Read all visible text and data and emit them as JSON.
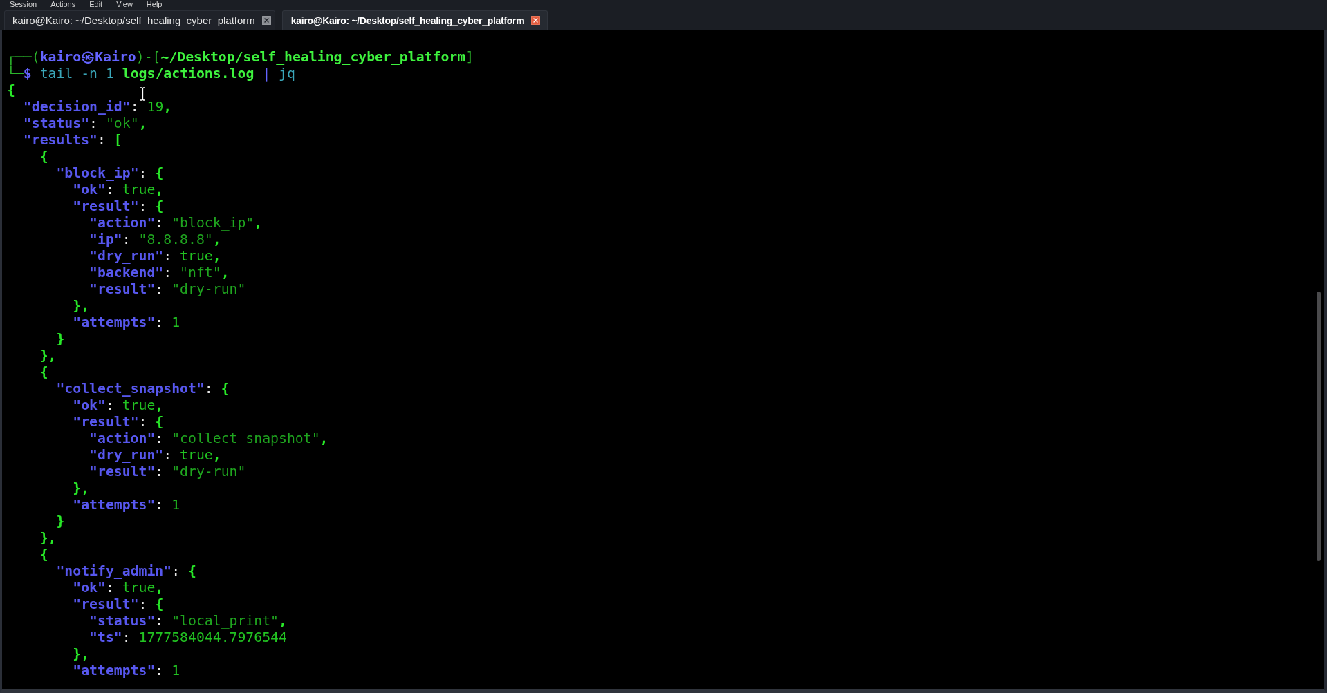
{
  "menu": [
    "Session",
    "Actions",
    "Edit",
    "View",
    "Help"
  ],
  "tabs": [
    {
      "label": "kairo@Kairo: ~/Desktop/self_healing_cyber_platform",
      "selected": false
    },
    {
      "label": "kairo@Kairo: ~/Desktop/self_healing_cyber_platform",
      "selected": true
    }
  ],
  "terminal": {
    "prompt": [
      {
        "segments": [
          {
            "text": "┌──(",
            "kind": "frame"
          },
          {
            "text": "kairo㉿Kairo",
            "kind": "accent"
          },
          {
            "text": ")-[",
            "kind": "frame"
          },
          {
            "text": "~/Desktop/self_healing_cyber_platform",
            "kind": "path"
          },
          {
            "text": "]",
            "kind": "frame"
          }
        ]
      },
      {
        "segments": [
          {
            "text": "└─",
            "kind": "frame"
          },
          {
            "text": "$",
            "kind": "accent"
          },
          {
            "text": " tail -n 1 ",
            "kind": "command"
          },
          {
            "text": "logs/actions.log",
            "kind": "path"
          },
          {
            "text": " |",
            "kind": "accent"
          },
          {
            "text": " jq",
            "kind": "command"
          }
        ]
      }
    ],
    "output": [
      {
        "segments": [
          {
            "text": "{",
            "kind": "punct"
          }
        ],
        "children": [
          {
            "segments": [
              {
                "text": "\"decision_id\"",
                "kind": "key"
              },
              {
                "text": ": ",
                "kind": "colon"
              },
              {
                "text": "19",
                "kind": "literal"
              },
              {
                "text": ",",
                "kind": "punct"
              }
            ]
          },
          {
            "segments": [
              {
                "text": "\"status\"",
                "kind": "key"
              },
              {
                "text": ": ",
                "kind": "colon"
              },
              {
                "text": "\"ok\"",
                "kind": "string"
              },
              {
                "text": ",",
                "kind": "punct"
              }
            ]
          },
          {
            "segments": [
              {
                "text": "\"results\"",
                "kind": "key"
              },
              {
                "text": ": ",
                "kind": "colon"
              },
              {
                "text": "[",
                "kind": "punct"
              }
            ],
            "children": [
              {
                "segments": [
                  {
                    "text": "{",
                    "kind": "punct"
                  }
                ],
                "children": [
                  {
                    "segments": [
                      {
                        "text": "\"block_ip\"",
                        "kind": "key"
                      },
                      {
                        "text": ": ",
                        "kind": "colon"
                      },
                      {
                        "text": "{",
                        "kind": "punct"
                      }
                    ],
                    "children": [
                      {
                        "segments": [
                          {
                            "text": "\"ok\"",
                            "kind": "key"
                          },
                          {
                            "text": ": ",
                            "kind": "colon"
                          },
                          {
                            "text": "true",
                            "kind": "literal"
                          },
                          {
                            "text": ",",
                            "kind": "punct"
                          }
                        ]
                      },
                      {
                        "segments": [
                          {
                            "text": "\"result\"",
                            "kind": "key"
                          },
                          {
                            "text": ": ",
                            "kind": "colon"
                          },
                          {
                            "text": "{",
                            "kind": "punct"
                          }
                        ],
                        "children": [
                          {
                            "segments": [
                              {
                                "text": "\"action\"",
                                "kind": "key"
                              },
                              {
                                "text": ": ",
                                "kind": "colon"
                              },
                              {
                                "text": "\"block_ip\"",
                                "kind": "string"
                              },
                              {
                                "text": ",",
                                "kind": "punct"
                              }
                            ]
                          },
                          {
                            "segments": [
                              {
                                "text": "\"ip\"",
                                "kind": "key"
                              },
                              {
                                "text": ": ",
                                "kind": "colon"
                              },
                              {
                                "text": "\"8.8.8.8\"",
                                "kind": "string"
                              },
                              {
                                "text": ",",
                                "kind": "punct"
                              }
                            ]
                          },
                          {
                            "segments": [
                              {
                                "text": "\"dry_run\"",
                                "kind": "key"
                              },
                              {
                                "text": ": ",
                                "kind": "colon"
                              },
                              {
                                "text": "true",
                                "kind": "literal"
                              },
                              {
                                "text": ",",
                                "kind": "punct"
                              }
                            ]
                          },
                          {
                            "segments": [
                              {
                                "text": "\"backend\"",
                                "kind": "key"
                              },
                              {
                                "text": ": ",
                                "kind": "colon"
                              },
                              {
                                "text": "\"nft\"",
                                "kind": "string"
                              },
                              {
                                "text": ",",
                                "kind": "punct"
                              }
                            ]
                          },
                          {
                            "segments": [
                              {
                                "text": "\"result\"",
                                "kind": "key"
                              },
                              {
                                "text": ": ",
                                "kind": "colon"
                              },
                              {
                                "text": "\"dry-run\"",
                                "kind": "string"
                              }
                            ]
                          }
                        ]
                      },
                      {
                        "segments": [
                          {
                            "text": "}",
                            "kind": "punct"
                          },
                          {
                            "text": ",",
                            "kind": "punct"
                          }
                        ]
                      },
                      {
                        "segments": [
                          {
                            "text": "\"attempts\"",
                            "kind": "key"
                          },
                          {
                            "text": ": ",
                            "kind": "colon"
                          },
                          {
                            "text": "1",
                            "kind": "literal"
                          }
                        ]
                      }
                    ]
                  },
                  {
                    "segments": [
                      {
                        "text": "}",
                        "kind": "punct"
                      }
                    ]
                  }
                ]
              },
              {
                "segments": [
                  {
                    "text": "}",
                    "kind": "punct"
                  },
                  {
                    "text": ",",
                    "kind": "punct"
                  }
                ]
              },
              {
                "segments": [
                  {
                    "text": "{",
                    "kind": "punct"
                  }
                ],
                "children": [
                  {
                    "segments": [
                      {
                        "text": "\"collect_snapshot\"",
                        "kind": "key"
                      },
                      {
                        "text": ": ",
                        "kind": "colon"
                      },
                      {
                        "text": "{",
                        "kind": "punct"
                      }
                    ],
                    "children": [
                      {
                        "segments": [
                          {
                            "text": "\"ok\"",
                            "kind": "key"
                          },
                          {
                            "text": ": ",
                            "kind": "colon"
                          },
                          {
                            "text": "true",
                            "kind": "literal"
                          },
                          {
                            "text": ",",
                            "kind": "punct"
                          }
                        ]
                      },
                      {
                        "segments": [
                          {
                            "text": "\"result\"",
                            "kind": "key"
                          },
                          {
                            "text": ": ",
                            "kind": "colon"
                          },
                          {
                            "text": "{",
                            "kind": "punct"
                          }
                        ],
                        "children": [
                          {
                            "segments": [
                              {
                                "text": "\"action\"",
                                "kind": "key"
                              },
                              {
                                "text": ": ",
                                "kind": "colon"
                              },
                              {
                                "text": "\"collect_snapshot\"",
                                "kind": "string"
                              },
                              {
                                "text": ",",
                                "kind": "punct"
                              }
                            ]
                          },
                          {
                            "segments": [
                              {
                                "text": "\"dry_run\"",
                                "kind": "key"
                              },
                              {
                                "text": ": ",
                                "kind": "colon"
                              },
                              {
                                "text": "true",
                                "kind": "literal"
                              },
                              {
                                "text": ",",
                                "kind": "punct"
                              }
                            ]
                          },
                          {
                            "segments": [
                              {
                                "text": "\"result\"",
                                "kind": "key"
                              },
                              {
                                "text": ": ",
                                "kind": "colon"
                              },
                              {
                                "text": "\"dry-run\"",
                                "kind": "string"
                              }
                            ]
                          }
                        ]
                      },
                      {
                        "segments": [
                          {
                            "text": "}",
                            "kind": "punct"
                          },
                          {
                            "text": ",",
                            "kind": "punct"
                          }
                        ]
                      },
                      {
                        "segments": [
                          {
                            "text": "\"attempts\"",
                            "kind": "key"
                          },
                          {
                            "text": ": ",
                            "kind": "colon"
                          },
                          {
                            "text": "1",
                            "kind": "literal"
                          }
                        ]
                      }
                    ]
                  },
                  {
                    "segments": [
                      {
                        "text": "}",
                        "kind": "punct"
                      }
                    ]
                  }
                ]
              },
              {
                "segments": [
                  {
                    "text": "}",
                    "kind": "punct"
                  },
                  {
                    "text": ",",
                    "kind": "punct"
                  }
                ]
              },
              {
                "segments": [
                  {
                    "text": "{",
                    "kind": "punct"
                  }
                ],
                "children": [
                  {
                    "segments": [
                      {
                        "text": "\"notify_admin\"",
                        "kind": "key"
                      },
                      {
                        "text": ": ",
                        "kind": "colon"
                      },
                      {
                        "text": "{",
                        "kind": "punct"
                      }
                    ],
                    "children": [
                      {
                        "segments": [
                          {
                            "text": "\"ok\"",
                            "kind": "key"
                          },
                          {
                            "text": ": ",
                            "kind": "colon"
                          },
                          {
                            "text": "true",
                            "kind": "literal"
                          },
                          {
                            "text": ",",
                            "kind": "punct"
                          }
                        ]
                      },
                      {
                        "segments": [
                          {
                            "text": "\"result\"",
                            "kind": "key"
                          },
                          {
                            "text": ": ",
                            "kind": "colon"
                          },
                          {
                            "text": "{",
                            "kind": "punct"
                          }
                        ],
                        "children": [
                          {
                            "segments": [
                              {
                                "text": "\"status\"",
                                "kind": "key"
                              },
                              {
                                "text": ": ",
                                "kind": "colon"
                              },
                              {
                                "text": "\"local_print\"",
                                "kind": "string"
                              },
                              {
                                "text": ",",
                                "kind": "punct"
                              }
                            ]
                          },
                          {
                            "segments": [
                              {
                                "text": "\"ts\"",
                                "kind": "key"
                              },
                              {
                                "text": ": ",
                                "kind": "colon"
                              },
                              {
                                "text": "1777584044.7976544",
                                "kind": "literal"
                              }
                            ]
                          }
                        ]
                      },
                      {
                        "segments": [
                          {
                            "text": "}",
                            "kind": "punct"
                          },
                          {
                            "text": ",",
                            "kind": "punct"
                          }
                        ]
                      },
                      {
                        "segments": [
                          {
                            "text": "\"attempts\"",
                            "kind": "key"
                          },
                          {
                            "text": ": ",
                            "kind": "colon"
                          },
                          {
                            "text": "1",
                            "kind": "literal"
                          }
                        ]
                      }
                    ]
                  }
                ]
              }
            ]
          }
        ]
      }
    ]
  }
}
